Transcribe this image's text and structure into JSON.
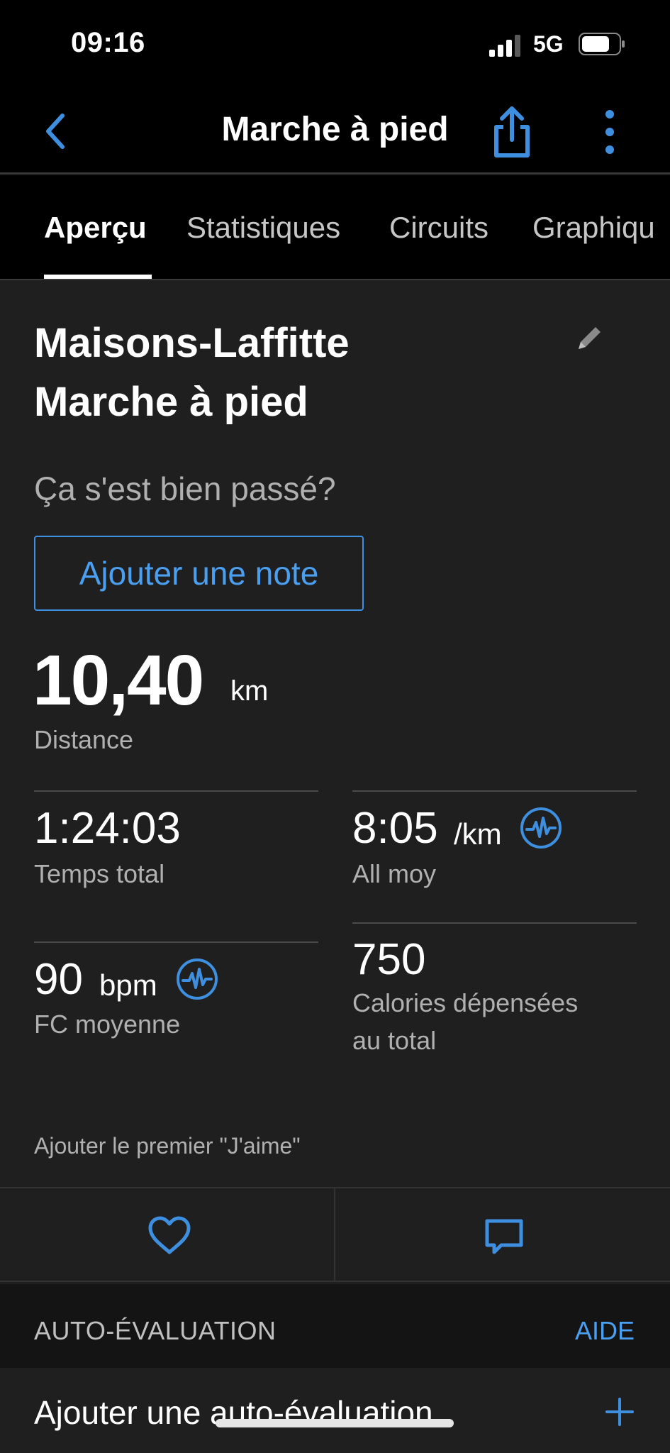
{
  "status_bar": {
    "time": "09:16",
    "network": "5G"
  },
  "nav": {
    "title": "Marche à pied"
  },
  "tabs": [
    {
      "label": "Aperçu",
      "active": true
    },
    {
      "label": "Statistiques",
      "active": false
    },
    {
      "label": "Circuits",
      "active": false
    },
    {
      "label": "Graphiqu",
      "active": false
    }
  ],
  "activity": {
    "title_line1": "Maisons-Laffitte",
    "title_line2": "Marche à pied",
    "question": "Ça s'est bien passé?",
    "add_note_label": "Ajouter une note"
  },
  "distance": {
    "value": "10,40",
    "unit": "km",
    "label": "Distance"
  },
  "stats": {
    "total_time": {
      "value": "1:24:03",
      "label": "Temps total"
    },
    "avg_pace": {
      "value": "8:05",
      "unit": "/km",
      "label": "All moy"
    },
    "avg_hr": {
      "value": "90",
      "unit": "bpm",
      "label": "FC moyenne"
    },
    "calories": {
      "value": "750",
      "label_line1": "Calories dépensées",
      "label_line2": "au total"
    }
  },
  "social": {
    "likes_text": "Ajouter le premier \"J'aime\""
  },
  "self_eval": {
    "section_title": "AUTO-ÉVALUATION",
    "help_label": "AIDE",
    "add_label": "Ajouter une auto-évaluation"
  },
  "colors": {
    "accent": "#3f8fe0",
    "background": "#1f1f1f",
    "bar_background": "#000000"
  }
}
